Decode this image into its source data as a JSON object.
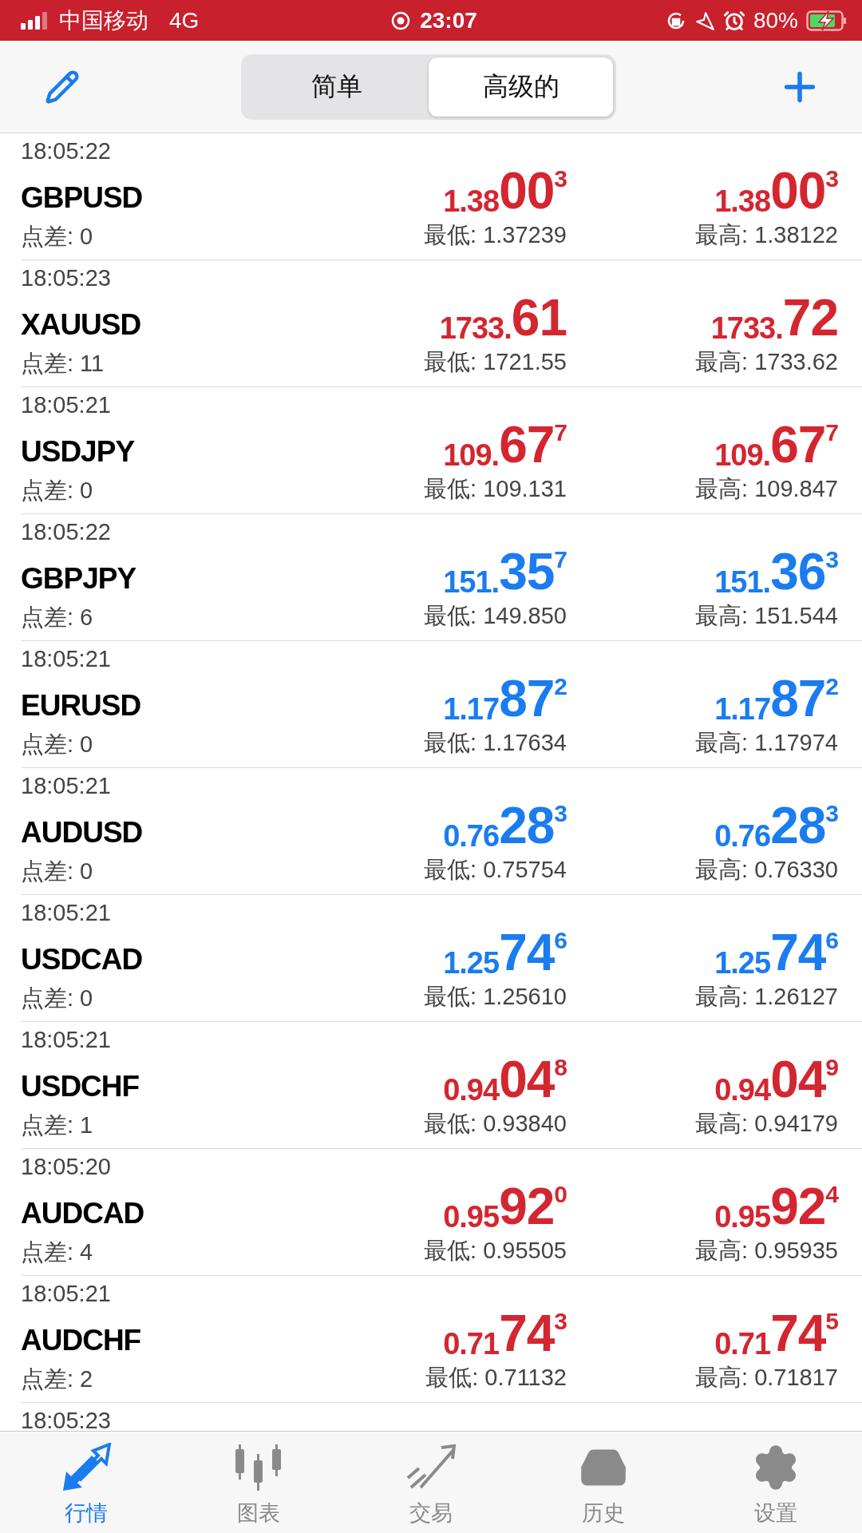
{
  "status_bar": {
    "carrier": "中国移动",
    "network": "4G",
    "time": "23:07",
    "battery": "80%"
  },
  "segments": [
    {
      "label": "简单",
      "selected": false
    },
    {
      "label": "高级的",
      "selected": true
    }
  ],
  "quotes": [
    {
      "time": "18:05:22",
      "symbol": "GBPUSD",
      "spread": "点差: 0",
      "color": "#d42630",
      "bid": {
        "small": "1.38",
        "big": "00",
        "sup": "3"
      },
      "ask": {
        "small": "1.38",
        "big": "00",
        "sup": "3"
      },
      "low": "最低: 1.37239",
      "high": "最高: 1.38122"
    },
    {
      "time": "18:05:23",
      "symbol": "XAUUSD",
      "spread": "点差: 11",
      "color": "#d42630",
      "bid": {
        "small": "1733.",
        "big": "61"
      },
      "ask": {
        "small": "1733.",
        "big": "72"
      },
      "low": "最低: 1721.55",
      "high": "最高: 1733.62"
    },
    {
      "time": "18:05:21",
      "symbol": "USDJPY",
      "spread": "点差: 0",
      "color": "#d42630",
      "bid": {
        "small": "109.",
        "big": "67",
        "sup": "7"
      },
      "ask": {
        "small": "109.",
        "big": "67",
        "sup": "7"
      },
      "low": "最低: 109.131",
      "high": "最高: 109.847"
    },
    {
      "time": "18:05:22",
      "symbol": "GBPJPY",
      "spread": "点差: 6",
      "color": "#1a7cf0",
      "bid": {
        "small": "151.",
        "big": "35",
        "sup": "7"
      },
      "ask": {
        "small": "151.",
        "big": "36",
        "sup": "3"
      },
      "low": "最低: 149.850",
      "high": "最高: 151.544"
    },
    {
      "time": "18:05:21",
      "symbol": "EURUSD",
      "spread": "点差: 0",
      "color": "#1a7cf0",
      "bid": {
        "small": "1.17",
        "big": "87",
        "sup": "2"
      },
      "ask": {
        "small": "1.17",
        "big": "87",
        "sup": "2"
      },
      "low": "最低: 1.17634",
      "high": "最高: 1.17974"
    },
    {
      "time": "18:05:21",
      "symbol": "AUDUSD",
      "spread": "点差: 0",
      "color": "#1a7cf0",
      "bid": {
        "small": "0.76",
        "big": "28",
        "sup": "3"
      },
      "ask": {
        "small": "0.76",
        "big": "28",
        "sup": "3"
      },
      "low": "最低: 0.75754",
      "high": "最高: 0.76330"
    },
    {
      "time": "18:05:21",
      "symbol": "USDCAD",
      "spread": "点差: 0",
      "color": "#1a7cf0",
      "bid": {
        "small": "1.25",
        "big": "74",
        "sup": "6"
      },
      "ask": {
        "small": "1.25",
        "big": "74",
        "sup": "6"
      },
      "low": "最低: 1.25610",
      "high": "最高: 1.26127"
    },
    {
      "time": "18:05:21",
      "symbol": "USDCHF",
      "spread": "点差: 1",
      "color": "#d42630",
      "bid": {
        "small": "0.94",
        "big": "04",
        "sup": "8"
      },
      "ask": {
        "small": "0.94",
        "big": "04",
        "sup": "9"
      },
      "low": "最低: 0.93840",
      "high": "最高: 0.94179"
    },
    {
      "time": "18:05:20",
      "symbol": "AUDCAD",
      "spread": "点差: 4",
      "color": "#d42630",
      "bid": {
        "small": "0.95",
        "big": "92",
        "sup": "0"
      },
      "ask": {
        "small": "0.95",
        "big": "92",
        "sup": "4"
      },
      "low": "最低: 0.95505",
      "high": "最高: 0.95935"
    },
    {
      "time": "18:05:21",
      "symbol": "AUDCHF",
      "spread": "点差: 2",
      "color": "#d42630",
      "bid": {
        "small": "0.71",
        "big": "74",
        "sup": "3"
      },
      "ask": {
        "small": "0.71",
        "big": "74",
        "sup": "5"
      },
      "low": "最低: 0.71132",
      "high": "最高: 0.71817"
    },
    {
      "time": "18:05:23"
    }
  ],
  "tab_bar": [
    {
      "kind": "quotes",
      "label": "行情",
      "selected": true
    },
    {
      "kind": "chart",
      "label": "图表",
      "selected": false
    },
    {
      "kind": "trade",
      "label": "交易",
      "selected": false
    },
    {
      "kind": "history",
      "label": "历史",
      "selected": false
    },
    {
      "kind": "settings",
      "label": "设置",
      "selected": false
    }
  ]
}
